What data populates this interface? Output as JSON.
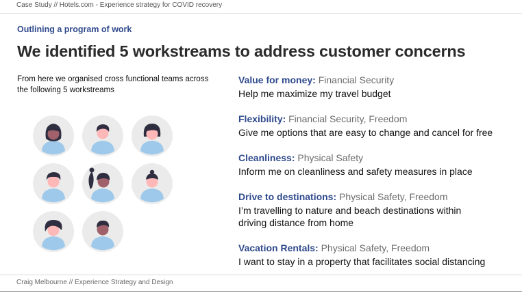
{
  "header": {
    "breadcrumb": "Case Study // Hotels.com - Experience strategy for COVID recovery"
  },
  "section_label": "Outlining a program of work",
  "title": "We identified 5 workstreams to address customer concerns",
  "intro": "From here we organised cross functional teams across the following 5 workstreams",
  "colors": {
    "accent": "#2f4a8c",
    "avatar_bg": "#ebebeb",
    "shirt": "#9ec9ea",
    "hair": "#2f2e41",
    "skin_light": "#ffb8b8",
    "skin_dark": "#a0616a"
  },
  "avatars": [
    {
      "icon": "person-avatar-icon"
    },
    {
      "icon": "person-avatar-icon"
    },
    {
      "icon": "person-avatar-icon"
    },
    {
      "icon": "person-avatar-icon"
    },
    {
      "icon": "person-avatar-icon"
    },
    {
      "icon": "person-avatar-icon"
    },
    {
      "icon": "person-avatar-icon"
    },
    {
      "icon": "person-avatar-icon"
    }
  ],
  "workstreams": [
    {
      "name": "Value for money:",
      "tags": "Financial Security",
      "desc": "Help me maximize my travel budget"
    },
    {
      "name": "Flexibility:",
      "tags": "Financial Security, Freedom",
      "desc": "Give me options that are easy to change and cancel for free"
    },
    {
      "name": "Cleanliness:",
      "tags": "Physical Safety",
      "desc": "Inform me on cleanliness and safety measures in place"
    },
    {
      "name": "Drive to destinations:",
      "tags": "Physical Safety, Freedom",
      "desc": "I’m travelling to nature and beach destinations within driving distance from home"
    },
    {
      "name": "Vacation Rentals:",
      "tags": "Physical Safety, Freedom",
      "desc": "I want to stay in a property that facilitates social distancing"
    }
  ],
  "footer": {
    "credit": "Craig Melbourne // Experience Strategy and Design"
  }
}
